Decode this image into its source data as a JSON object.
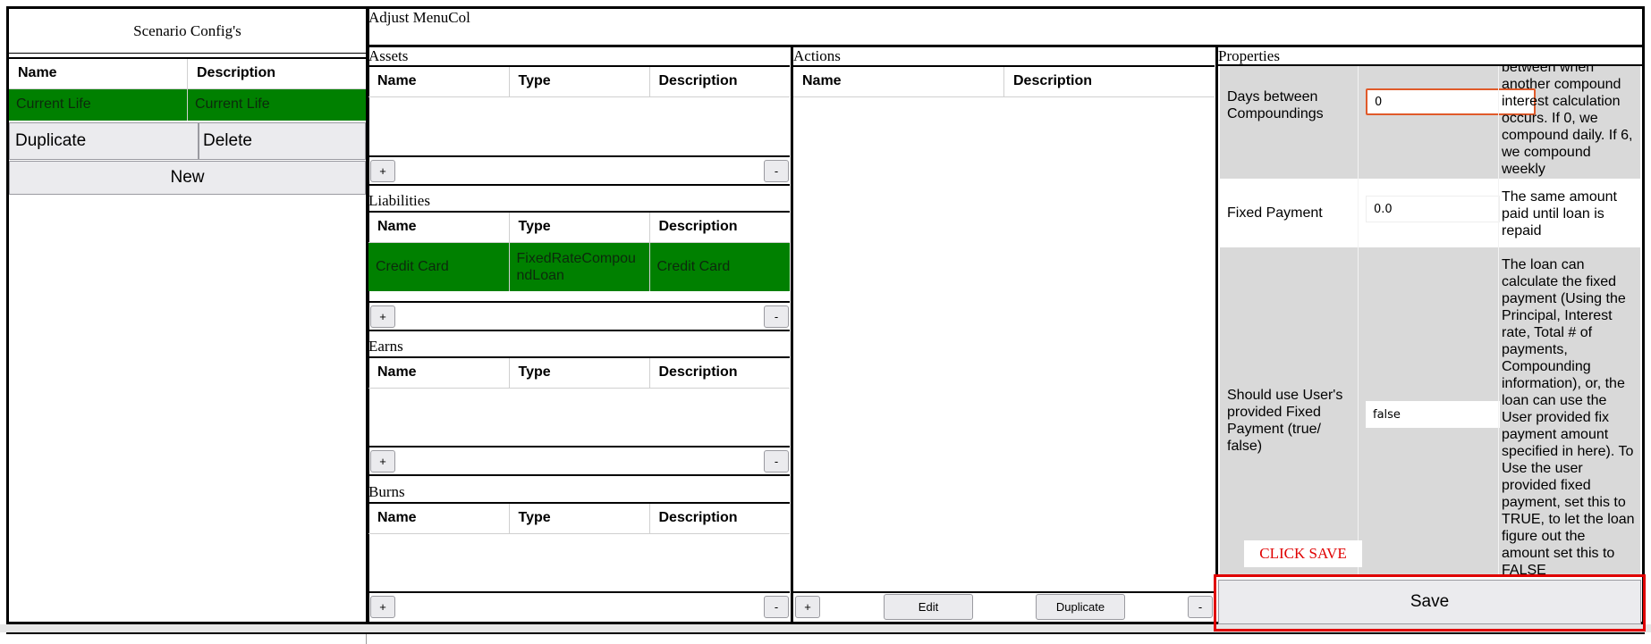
{
  "left": {
    "title": "Scenario Config's",
    "columns": [
      "Name",
      "Description"
    ],
    "rows": [
      {
        "name": "Current Life",
        "description": "Current Life"
      }
    ],
    "duplicate_label": "Duplicate",
    "delete_label": "Delete",
    "new_label": "New"
  },
  "header": {
    "title": "Adjust MenuCol"
  },
  "sections": {
    "assets": {
      "label": "Assets",
      "columns": [
        "Name",
        "Type",
        "Description"
      ],
      "rows": []
    },
    "liabilities": {
      "label": "Liabilities",
      "columns": [
        "Name",
        "Type",
        "Description"
      ],
      "rows": [
        {
          "name": "Credit Card",
          "type": "FixedRateCompoundLoan",
          "description": "Credit Card"
        }
      ]
    },
    "earns": {
      "label": "Earns",
      "columns": [
        "Name",
        "Type",
        "Description"
      ],
      "rows": []
    },
    "burns": {
      "label": "Burns",
      "columns": [
        "Name",
        "Type",
        "Description"
      ],
      "rows": []
    },
    "add_label": "+",
    "remove_label": "-"
  },
  "actions": {
    "label": "Actions",
    "columns": [
      "Name",
      "Description"
    ],
    "add_label": "+",
    "edit_label": "Edit",
    "duplicate_label": "Duplicate",
    "remove_label": "-"
  },
  "properties": {
    "label": "Properties",
    "rows": [
      {
        "name": "Days between Compoundings",
        "value": "0",
        "description": "between when another compound interest calculation occurs. If 0, we compound daily. If 6, we compound weekly"
      },
      {
        "name": "Fixed Payment",
        "value": "0.0",
        "description": "The same amount paid until loan is repaid"
      },
      {
        "name": "Should use User's provided Fixed Payment (true/ false)",
        "value": "false",
        "description": "The loan can calculate the fixed payment (Using the Principal, Interest rate, Total # of payments, Compounding information), or, the loan can use the User provided fix payment amount specified in here). To Use the user provided fixed payment, set this to TRUE, to let the loan figure out the amount set this to FALSE"
      }
    ],
    "annotation": "CLICK SAVE",
    "save_label": "Save",
    "accent_color": "#e00000"
  }
}
